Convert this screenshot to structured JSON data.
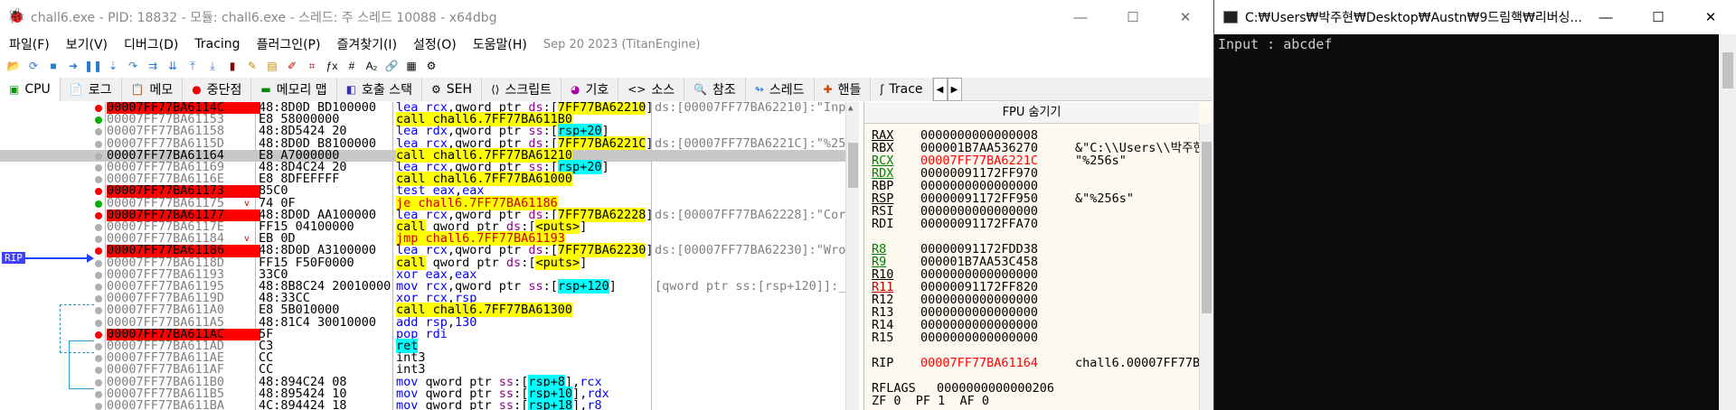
{
  "dbg": {
    "title": "chall6.exe - PID: 18832 - 모듈: chall6.exe - 스레드: 주 스레드 10088 - x64dbg",
    "window_buttons": [
      "—",
      "☐",
      "✕"
    ],
    "menu": [
      "파일(F)",
      "보기(V)",
      "디버그(D)",
      "Tracing",
      "플러그인(P)",
      "즐겨찾기(I)",
      "설정(O)",
      "도움말(H)"
    ],
    "build": "Sep 20 2023 (TitanEngine)",
    "tabs": [
      "CPU",
      "로그",
      "메모",
      "중단점",
      "메모리 맵",
      "호출 스택",
      "SEH",
      "스크립트",
      "기호",
      "소스",
      "참조",
      "스레드",
      "핸들",
      "Trace"
    ],
    "tab_icons": [
      "cpu-icon",
      "log-icon",
      "notes-icon",
      "breakpoint-icon",
      "memory-map-icon",
      "callstack-icon",
      "seh-icon",
      "script-icon",
      "symbols-icon",
      "source-icon",
      "references-icon",
      "threads-icon",
      "handles-icon",
      "trace-icon"
    ],
    "rip_label": "RIP",
    "regs_header": "FPU 숨기기"
  },
  "disasm": [
    {
      "dot": "red",
      "addr": "00007FF77BA6114C",
      "bp": true,
      "bytes": "48:8D0D BD100000",
      "instr": [
        [
          "op",
          "lea "
        ],
        [
          "reg",
          "rcx"
        ],
        [
          "t",
          ",qword ptr "
        ],
        [
          "seg",
          "ds"
        ],
        [
          "t",
          ":["
        ],
        [
          "call",
          "7FF77BA62210"
        ],
        [
          "t",
          "]"
        ]
      ],
      "cmt": "ds:[00007FF77BA62210]:\"Inp"
    },
    {
      "dot": "green",
      "addr": "00007FF77BA61153",
      "bytes": "E8 58000000",
      "instr": [
        [
          "call",
          "call chall6.7FF77BA611B0"
        ]
      ],
      "cmt": ""
    },
    {
      "dot": "gray",
      "addr": "00007FF77BA61158",
      "bytes": "48:8D5424 20",
      "instr": [
        [
          "op",
          "lea "
        ],
        [
          "reg",
          "rdx"
        ],
        [
          "t",
          ",qword ptr "
        ],
        [
          "seg",
          "ss"
        ],
        [
          "t",
          ":["
        ],
        [
          "brk",
          "rsp+20"
        ],
        [
          "t",
          "]"
        ]
      ],
      "cmt": ""
    },
    {
      "dot": "gray",
      "addr": "00007FF77BA6115D",
      "bytes": "48:8D0D B8100000",
      "instr": [
        [
          "op",
          "lea "
        ],
        [
          "reg",
          "rcx"
        ],
        [
          "t",
          ",qword ptr "
        ],
        [
          "seg",
          "ds"
        ],
        [
          "t",
          ":["
        ],
        [
          "call",
          "7FF77BA6221C"
        ],
        [
          "t",
          "]"
        ]
      ],
      "cmt": "ds:[00007FF77BA6221C]:\"%25"
    },
    {
      "dot": "gray",
      "addr": "00007FF77BA61164",
      "rip": true,
      "sel": true,
      "bytes": "E8 A7000000",
      "instr": [
        [
          "call",
          "call chall6.7FF77BA61210"
        ]
      ],
      "cmt": ""
    },
    {
      "dot": "gray",
      "addr": "00007FF77BA61169",
      "bytes": "48:8D4C24 20",
      "instr": [
        [
          "op",
          "lea "
        ],
        [
          "reg",
          "rcx"
        ],
        [
          "t",
          ",qword ptr "
        ],
        [
          "seg",
          "ss"
        ],
        [
          "t",
          ":["
        ],
        [
          "brk",
          "rsp+20"
        ],
        [
          "t",
          "]"
        ]
      ],
      "cmt": ""
    },
    {
      "dot": "gray",
      "addr": "00007FF77BA6116E",
      "bytes": "E8 8DFEFFFF",
      "instr": [
        [
          "call",
          "call chall6.7FF77BA61000"
        ]
      ],
      "cmt": ""
    },
    {
      "dot": "red",
      "addr": "00007FF77BA61173",
      "bp": true,
      "bytes": "85C0",
      "instr": [
        [
          "op",
          "test "
        ],
        [
          "reg",
          "eax"
        ],
        [
          "t",
          ","
        ],
        [
          "reg",
          "eax"
        ]
      ],
      "cmt": ""
    },
    {
      "dot": "green",
      "addr": "00007FF77BA61175",
      "jm": "v",
      "bytes": "74 0F",
      "instr": [
        [
          "jmp",
          "je chall6.7FF77BA61186"
        ]
      ],
      "cmt": ""
    },
    {
      "dot": "red",
      "addr": "00007FF77BA61177",
      "bp": true,
      "bytes": "48:8D0D AA100000",
      "instr": [
        [
          "op",
          "lea "
        ],
        [
          "reg",
          "rcx"
        ],
        [
          "t",
          ",qword ptr "
        ],
        [
          "seg",
          "ds"
        ],
        [
          "t",
          ":["
        ],
        [
          "call",
          "7FF77BA62228"
        ],
        [
          "t",
          "]"
        ]
      ],
      "cmt": "ds:[00007FF77BA62228]:\"Cor"
    },
    {
      "dot": "gray",
      "addr": "00007FF77BA6117E",
      "bytes": "FF15 04100000",
      "instr": [
        [
          "call",
          "call"
        ],
        [
          "t",
          " qword ptr "
        ],
        [
          "seg",
          "ds"
        ],
        [
          "t",
          ":["
        ],
        [
          "call",
          "<puts>"
        ],
        [
          "t",
          "]"
        ]
      ],
      "cmt": ""
    },
    {
      "dot": "gray",
      "addr": "00007FF77BA61184",
      "jm": "v",
      "bytes": "EB 0D",
      "instr": [
        [
          "jmp",
          "jmp chall6.7FF77BA61193"
        ]
      ],
      "cmt": ""
    },
    {
      "dot": "red",
      "addr": "00007FF77BA61186",
      "bp": true,
      "bytes": "48:8D0D A3100000",
      "instr": [
        [
          "op",
          "lea "
        ],
        [
          "reg",
          "rcx"
        ],
        [
          "t",
          ",qword ptr "
        ],
        [
          "seg",
          "ds"
        ],
        [
          "t",
          ":["
        ],
        [
          "call",
          "7FF77BA62230"
        ],
        [
          "t",
          "]"
        ]
      ],
      "cmt": "ds:[00007FF77BA62230]:\"Wro"
    },
    {
      "dot": "gray",
      "addr": "00007FF77BA6118D",
      "bytes": "FF15 F50F0000",
      "instr": [
        [
          "call",
          "call"
        ],
        [
          "t",
          " qword ptr "
        ],
        [
          "seg",
          "ds"
        ],
        [
          "t",
          ":["
        ],
        [
          "call",
          "<puts>"
        ],
        [
          "t",
          "]"
        ]
      ],
      "cmt": ""
    },
    {
      "dot": "gray",
      "addr": "00007FF77BA61193",
      "bytes": "33C0",
      "instr": [
        [
          "op",
          "xor "
        ],
        [
          "reg",
          "eax"
        ],
        [
          "t",
          ","
        ],
        [
          "reg",
          "eax"
        ]
      ],
      "cmt": ""
    },
    {
      "dot": "gray",
      "addr": "00007FF77BA61195",
      "bytes": "48:8B8C24 20010000",
      "instr": [
        [
          "op",
          "mov "
        ],
        [
          "reg",
          "rcx"
        ],
        [
          "t",
          ",qword ptr "
        ],
        [
          "seg",
          "ss"
        ],
        [
          "t",
          ":["
        ],
        [
          "brk",
          "rsp+120"
        ],
        [
          "t",
          "]"
        ]
      ],
      "cmt": "[qword ptr ss:[rsp+120]]:_"
    },
    {
      "dot": "gray",
      "addr": "00007FF77BA6119D",
      "bytes": "48:33CC",
      "instr": [
        [
          "op",
          "xor "
        ],
        [
          "reg",
          "rcx"
        ],
        [
          "t",
          ","
        ],
        [
          "reg",
          "rsp"
        ]
      ],
      "cmt": ""
    },
    {
      "dot": "gray",
      "addr": "00007FF77BA611A0",
      "bytes": "E8 5B010000",
      "instr": [
        [
          "call",
          "call chall6.7FF77BA61300"
        ]
      ],
      "cmt": ""
    },
    {
      "dot": "gray",
      "addr": "00007FF77BA611A5",
      "bytes": "48:81C4 30010000",
      "instr": [
        [
          "op",
          "add "
        ],
        [
          "reg",
          "rsp"
        ],
        [
          "t",
          ","
        ],
        [
          "num",
          "130"
        ]
      ],
      "cmt": ""
    },
    {
      "dot": "red",
      "addr": "00007FF77BA611AC",
      "bp": true,
      "bytes": "5F",
      "instr": [
        [
          "op",
          "pop "
        ],
        [
          "reg",
          "rdi"
        ]
      ],
      "cmt": ""
    },
    {
      "dot": "gray",
      "addr": "00007FF77BA611AD",
      "bytes": "C3",
      "instr": [
        [
          "ret",
          "ret"
        ]
      ],
      "cmt": ""
    },
    {
      "dot": "gray",
      "addr": "00007FF77BA611AE",
      "bytes": "CC",
      "instr": [
        [
          "t",
          "int3"
        ]
      ],
      "cmt": ""
    },
    {
      "dot": "gray",
      "addr": "00007FF77BA611AF",
      "bytes": "CC",
      "instr": [
        [
          "t",
          "int3"
        ]
      ],
      "cmt": ""
    },
    {
      "dot": "gray",
      "addr": "00007FF77BA611B0",
      "bytes": "48:894C24 08",
      "instr": [
        [
          "op",
          "mov "
        ],
        [
          "t",
          "qword ptr "
        ],
        [
          "seg",
          "ss"
        ],
        [
          "t",
          ":["
        ],
        [
          "brk",
          "rsp+8"
        ],
        [
          "t",
          "],"
        ],
        [
          "reg",
          "rcx"
        ]
      ],
      "cmt": ""
    },
    {
      "dot": "gray",
      "addr": "00007FF77BA611B5",
      "bytes": "48:895424 10",
      "instr": [
        [
          "op",
          "mov "
        ],
        [
          "t",
          "qword ptr "
        ],
        [
          "seg",
          "ss"
        ],
        [
          "t",
          ":["
        ],
        [
          "brk",
          "rsp+10"
        ],
        [
          "t",
          "],"
        ],
        [
          "reg",
          "rdx"
        ]
      ],
      "cmt": ""
    },
    {
      "dot": "gray",
      "addr": "00007FF77BA611BA",
      "bytes": "4C:894424 18",
      "instr": [
        [
          "op",
          "mov "
        ],
        [
          "t",
          "qword ptr "
        ],
        [
          "seg",
          "ss"
        ],
        [
          "t",
          ":["
        ],
        [
          "brk",
          "rsp+18"
        ],
        [
          "t",
          "],"
        ],
        [
          "reg",
          "r8"
        ]
      ],
      "cmt": ""
    }
  ],
  "registers": [
    {
      "name": "RAX",
      "ul": true,
      "val": "0000000000000008",
      "cmt": ""
    },
    {
      "name": "RBX",
      "val": "000001B7AA536270",
      "cmt": "&\"C:\\\\Users\\\\박주현"
    },
    {
      "name": "RCX",
      "ul": true,
      "green": true,
      "val": "00007FF77BA6221C",
      "chg": true,
      "cmt": "\"%256s\""
    },
    {
      "name": "RDX",
      "ul": true,
      "green": true,
      "val": "00000091172FF970",
      "cmt": ""
    },
    {
      "name": "RBP",
      "val": "0000000000000000",
      "cmt": ""
    },
    {
      "name": "RSP",
      "ul": true,
      "val": "00000091172FF950",
      "cmt": "&\"%256s\""
    },
    {
      "name": "RSI",
      "val": "0000000000000000",
      "cmt": ""
    },
    {
      "name": "RDI",
      "val": "00000091172FFA70",
      "cmt": ""
    },
    {
      "name": "",
      "val": "",
      "cmt": ""
    },
    {
      "name": "R8",
      "ul": true,
      "green": true,
      "val": "00000091172FDD38",
      "cmt": ""
    },
    {
      "name": "R9",
      "ul": true,
      "green": true,
      "val": "000001B7AA53C458",
      "cmt": ""
    },
    {
      "name": "R10",
      "ul": true,
      "val": "0000000000000000",
      "cmt": ""
    },
    {
      "name": "R11",
      "ul": true,
      "red": true,
      "val": "00000091172FF820",
      "cmt": ""
    },
    {
      "name": "R12",
      "val": "0000000000000000",
      "cmt": ""
    },
    {
      "name": "R13",
      "val": "0000000000000000",
      "cmt": ""
    },
    {
      "name": "R14",
      "val": "0000000000000000",
      "cmt": ""
    },
    {
      "name": "R15",
      "val": "0000000000000000",
      "cmt": ""
    },
    {
      "name": "",
      "val": "",
      "cmt": ""
    },
    {
      "name": "RIP",
      "val": "00007FF77BA61164",
      "chg": true,
      "cmt": "chall6.00007FF77BA"
    },
    {
      "name": "",
      "val": "",
      "cmt": ""
    },
    {
      "name": "RFLAGS",
      "val": "0000000000000206",
      "cmt": ""
    },
    {
      "name": "ZF 0  PF 1  AF 0",
      "val": "",
      "cmt": ""
    }
  ],
  "console": {
    "title": "C:₩Users₩박주현₩Desktop₩Austn₩9드림핵₩리버싱...",
    "buttons": [
      "—",
      "☐",
      "✕"
    ],
    "text": "Input : abcdef"
  }
}
